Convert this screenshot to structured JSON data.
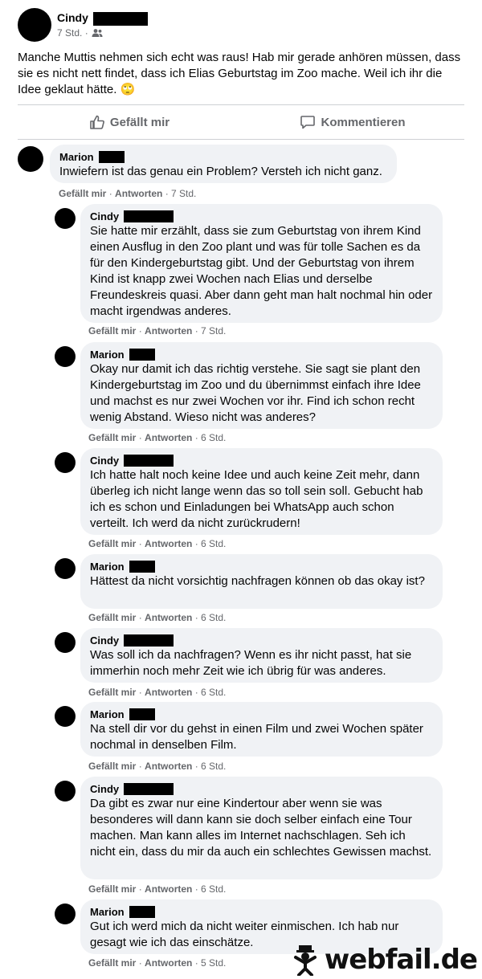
{
  "post": {
    "author": "Cindy",
    "time": "7 Std. ·",
    "text": "Manche Muttis nehmen sich echt was raus! Hab mir gerade anhören müssen, dass sie es nicht nett findet, dass ich Elias Geburtstag im Zoo mache. Weil ich ihr die Idee geklaut hätte. 🙄",
    "like_label": "Gefällt mir",
    "comment_label": "Kommentieren"
  },
  "comments": [
    {
      "author": "Marion",
      "text": "Inwiefern ist das genau ein Problem? Versteh ich nicht ganz.",
      "like": "Gefällt mir",
      "reply": "Antworten",
      "time": "7 Std."
    },
    {
      "author": "Cindy",
      "text": "Sie hatte mir erzählt, dass sie zum Geburtstag von ihrem Kind einen Ausflug in den Zoo plant und was für tolle Sachen es da für den Kindergeburtstag gibt. Und der Geburtstag von ihrem Kind ist knapp zwei Wochen nach Elias und derselbe Freundeskreis quasi. Aber dann geht man halt nochmal hin oder macht irgendwas anderes.",
      "like": "Gefällt mir",
      "reply": "Antworten",
      "time": "7 Std."
    },
    {
      "author": "Marion",
      "text": "Okay nur damit ich das richtig verstehe. Sie sagt sie plant den Kindergeburtstag im Zoo und du übernimmst einfach ihre Idee und machst es nur zwei Wochen vor ihr. Find ich schon recht wenig Abstand. Wieso nicht was anderes?",
      "like": "Gefällt mir",
      "reply": "Antworten",
      "time": "6 Std."
    },
    {
      "author": "Cindy",
      "text": "Ich hatte halt noch keine Idee und auch keine Zeit mehr, dann überleg ich nicht lange wenn das so toll sein soll. Gebucht hab ich es schon und Einladungen bei WhatsApp auch schon verteilt. Ich werd da nicht zurückrudern!",
      "like": "Gefällt mir",
      "reply": "Antworten",
      "time": "6 Std."
    },
    {
      "author": "Marion",
      "text": "Hättest da nicht vorsichtig nachfragen können ob das okay ist?",
      "like": "Gefällt mir",
      "reply": "Antworten",
      "time": "6 Std."
    },
    {
      "author": "Cindy",
      "text": "Was soll ich da nachfragen? Wenn es ihr nicht passt, hat sie immerhin noch mehr Zeit wie ich übrig für was anderes.",
      "like": "Gefällt mir",
      "reply": "Antworten",
      "time": "6 Std."
    },
    {
      "author": "Marion",
      "text": "Na stell dir vor du gehst in einen Film und zwei Wochen später nochmal in denselben Film.",
      "like": "Gefällt mir",
      "reply": "Antworten",
      "time": "6 Std."
    },
    {
      "author": "Cindy",
      "text": "Da gibt es zwar nur eine Kindertour aber wenn sie was besonderes will dann kann sie doch selber einfach eine Tour machen. Man kann alles im Internet nachschlagen. Seh ich nicht ein, dass du mir da auch ein schlechtes Gewissen machst.",
      "like": "Gefällt mir",
      "reply": "Antworten",
      "time": "6 Std."
    },
    {
      "author": "Marion",
      "text": "Gut ich werd mich da nicht weiter einmischen. Ich hab nur gesagt wie ich das einschätze.",
      "like": "Gefällt mir",
      "reply": "Antworten",
      "time": "5 Std."
    }
  ],
  "watermark": "webfail.de",
  "colors": {
    "bubble": "#f0f2f5",
    "meta": "#65676b",
    "divider": "#ced0d4"
  }
}
